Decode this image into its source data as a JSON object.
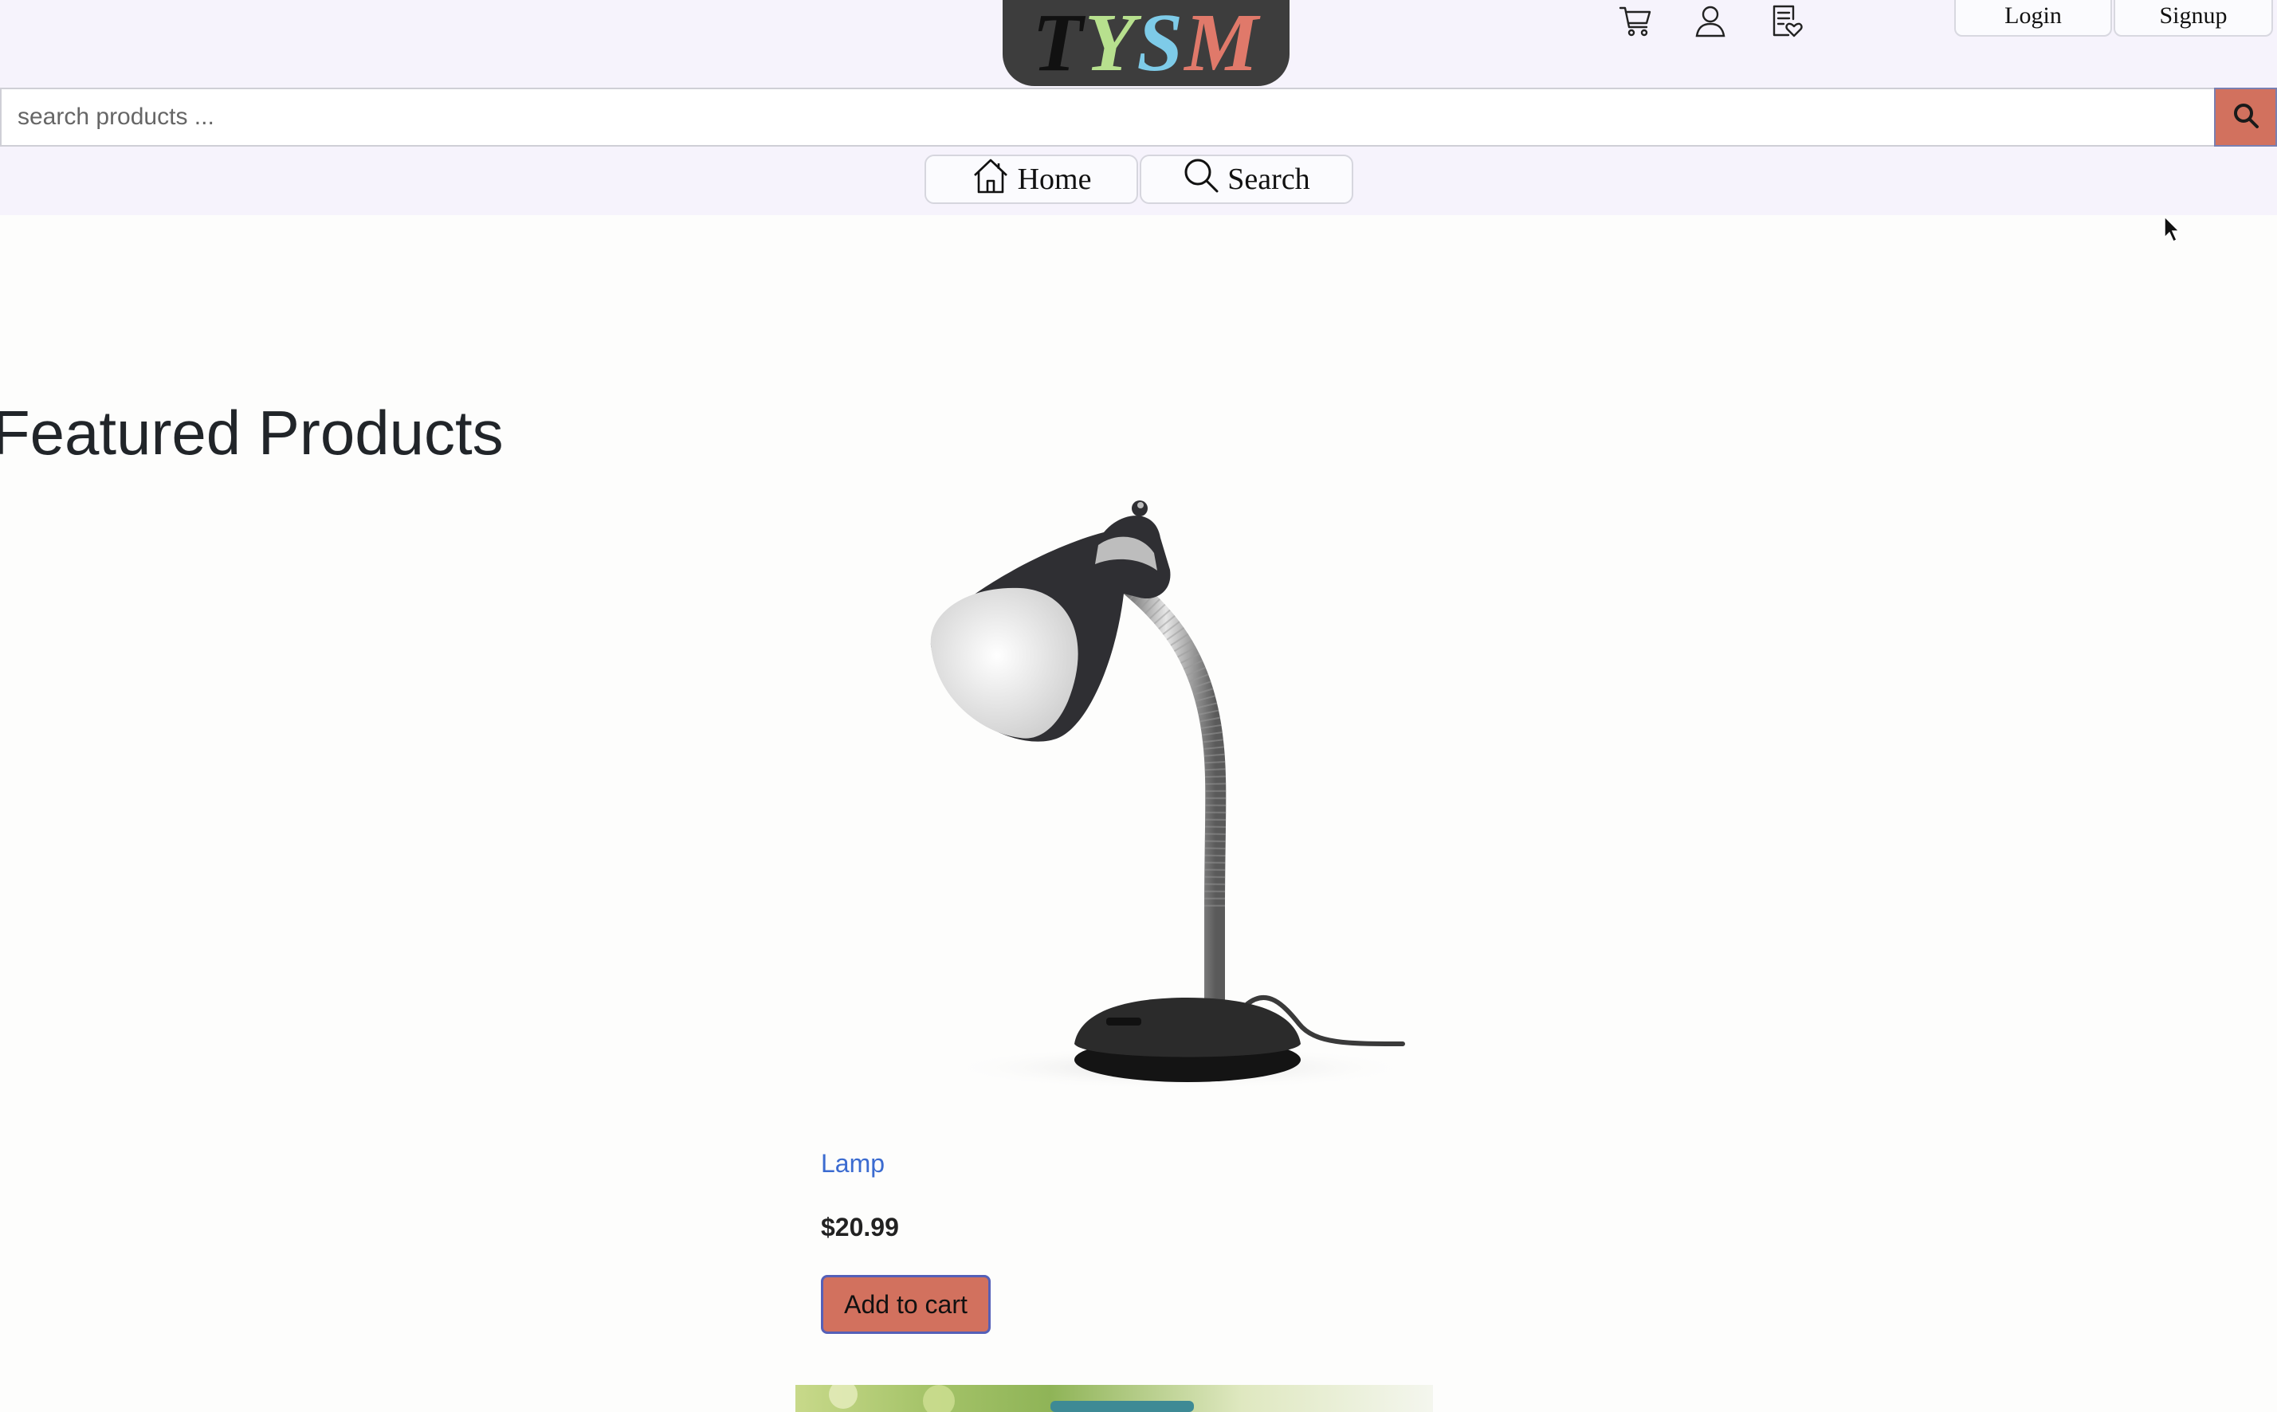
{
  "brand": {
    "logo_letters": [
      "T",
      "Y",
      "S",
      "M"
    ],
    "logo_colors": [
      "#111111",
      "#b7e08e",
      "#7ecbe8",
      "#e0796a"
    ]
  },
  "header": {
    "icons": [
      "cart-icon",
      "user-icon",
      "wishlist-icon"
    ],
    "login_label": "Login",
    "signup_label": "Signup"
  },
  "search": {
    "placeholder": "search products ...",
    "value": "",
    "button_icon": "search-icon"
  },
  "menu": {
    "home_label": "Home",
    "search_label": "Search"
  },
  "main": {
    "heading": "Featured Products",
    "products": [
      {
        "name": "Lamp",
        "price": "$20.99",
        "add_label": "Add to cart",
        "image": "desk-lamp"
      }
    ]
  },
  "colors": {
    "accent": "#d2715e",
    "header_bg": "#f6f3fc",
    "link": "#3b6bd0"
  }
}
